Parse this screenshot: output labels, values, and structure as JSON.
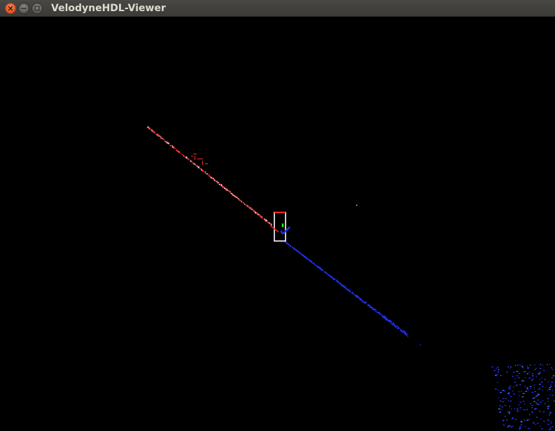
{
  "window": {
    "title": "VelodyneHDL-Viewer"
  },
  "titlebar": {
    "buttons": [
      {
        "name": "close",
        "icon": "close-icon",
        "color": "#e25420"
      },
      {
        "name": "minimize",
        "icon": "minimize-icon",
        "color": "#6b6a66"
      },
      {
        "name": "maximize",
        "icon": "maximize-icon",
        "color": "#6b6a66"
      }
    ]
  },
  "viewer": {
    "background": "#000000",
    "axis_colors": {
      "x": "#ff2020",
      "y": "#20ff20",
      "z": "#2020ff"
    },
    "point_color_near": "#ff2a2a",
    "point_color_far": "#2233ff",
    "sensor_box_color": "#ffffff"
  }
}
